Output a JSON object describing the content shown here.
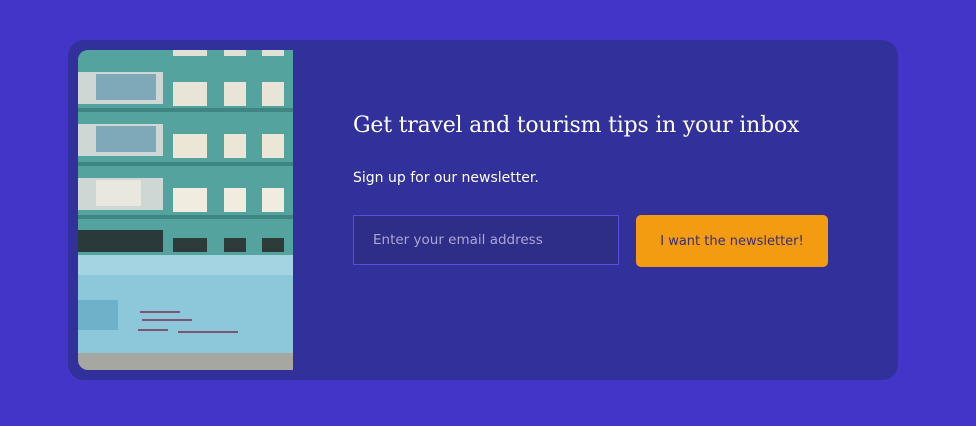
{
  "newsletter": {
    "heading": "Get travel and tourism tips in your inbox",
    "subtext": "Sign up for our newsletter.",
    "email_placeholder": "Enter your email address",
    "email_value": "",
    "button_label": "I want the newsletter!"
  },
  "colors": {
    "background": "#4335c8",
    "card": "#32309a",
    "button": "#f39c12",
    "input": "#2e2d88"
  }
}
